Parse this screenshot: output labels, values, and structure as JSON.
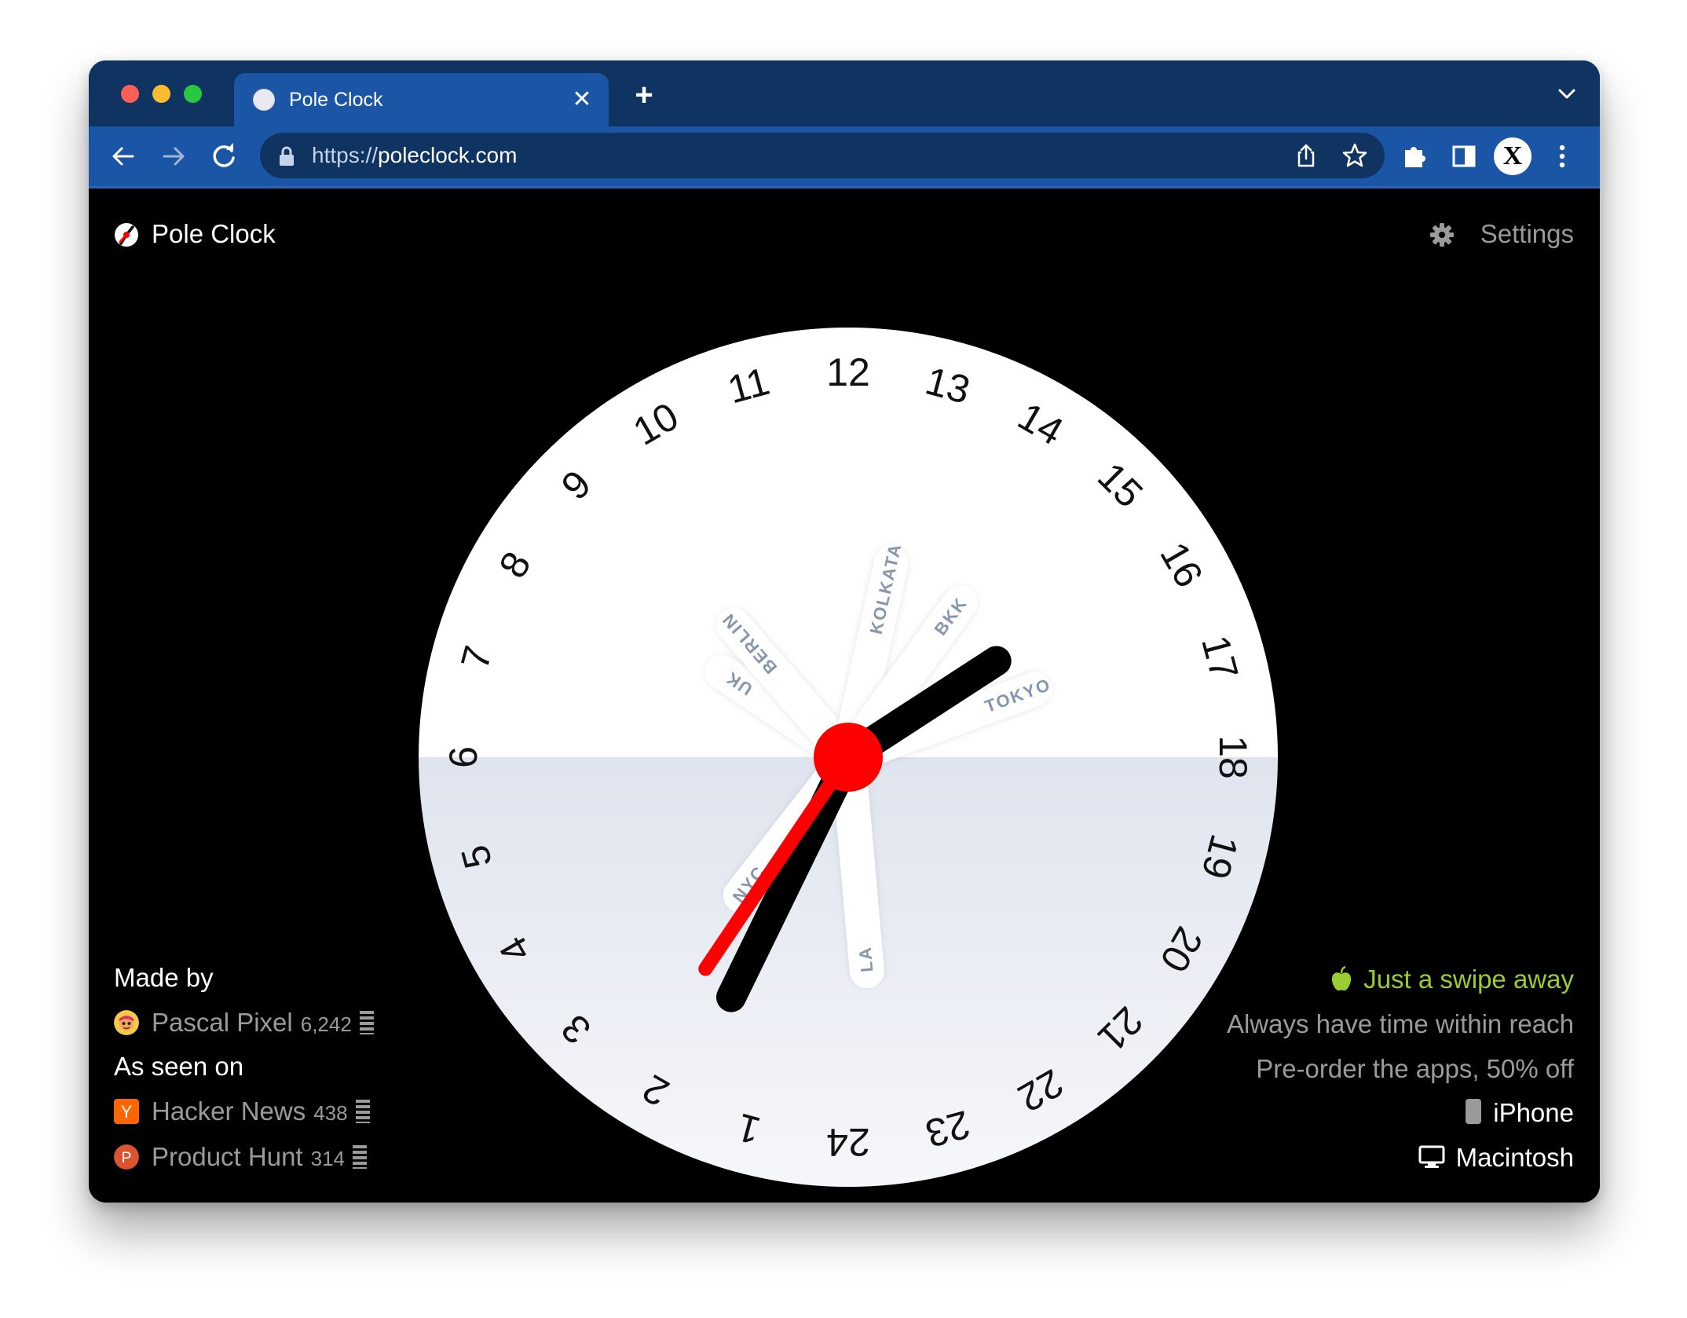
{
  "browser": {
    "tab_title": "Pole Clock",
    "tab_close": "✕",
    "new_tab": "+",
    "url_scheme": "https://",
    "url_host": "poleclock.com",
    "profile_initial": "X"
  },
  "header": {
    "brand": "Pole Clock",
    "settings_label": "Settings"
  },
  "clock": {
    "hours": [
      "24",
      "1",
      "2",
      "3",
      "4",
      "5",
      "6",
      "7",
      "8",
      "9",
      "10",
      "11",
      "12",
      "13",
      "14",
      "15",
      "16",
      "17",
      "18",
      "19",
      "20",
      "21",
      "22",
      "23"
    ],
    "cities": [
      "UK",
      "BERLIN",
      "KOLKATA",
      "BKK",
      "TOKYO",
      "NYC",
      "LA"
    ],
    "colors": {
      "day": "#ffffff",
      "night": "#dfe4ee",
      "hour_hand": "#000000",
      "local_hand": "#ff0000",
      "city_label": "#8596ad"
    }
  },
  "credits": {
    "made_by": "Made by",
    "author": {
      "name": "Pascal Pixel",
      "count": "6,242"
    },
    "as_seen_on": "As seen on",
    "sources": [
      {
        "name": "Hacker News",
        "count": "438",
        "icon_letter": "Y",
        "color": "#ff6600"
      },
      {
        "name": "Product Hunt",
        "count": "314",
        "icon_letter": "P",
        "color": "#da552f"
      }
    ]
  },
  "promo": {
    "headline": "Just a swipe away",
    "line1": "Always have time within reach",
    "line2": "Pre-order the apps, 50% off",
    "iphone": "iPhone",
    "mac": "Macintosh",
    "accent": "#9acd32"
  }
}
